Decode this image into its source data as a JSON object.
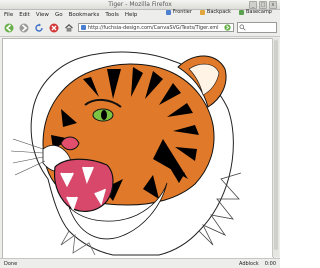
{
  "window": {
    "title": "Tiger - Mozilla Firefox"
  },
  "menu": {
    "items": [
      "File",
      "Edit",
      "View",
      "Go",
      "Bookmarks",
      "Tools",
      "Help"
    ]
  },
  "toolbar": {
    "url": "http://fuchsia-design.com/CanvaSVG/Tests/Tiger.xml",
    "bookmarks": [
      {
        "label": "Frontier"
      },
      {
        "label": "Backpack"
      },
      {
        "label": "Basecamp"
      }
    ]
  },
  "status": {
    "left": "Done",
    "right1": "Adblock",
    "right2": "0:00"
  },
  "colors": {
    "tiger_orange": "#e07a2a",
    "tiger_black": "#000000",
    "eye_green": "#7cc243",
    "mouth_red": "#d8486b"
  },
  "icons": [
    "back-arrow-icon",
    "forward-arrow-icon",
    "reload-icon",
    "stop-icon",
    "home-icon",
    "go-icon",
    "search-icon"
  ]
}
